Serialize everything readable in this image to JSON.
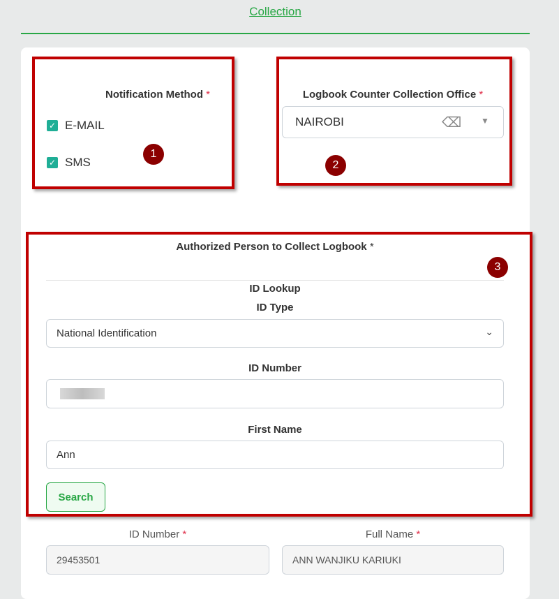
{
  "header": {
    "title": "Collection"
  },
  "notification": {
    "label": "Notification Method",
    "required": "*",
    "options": [
      {
        "label": "E-MAIL",
        "checked": true
      },
      {
        "label": "SMS",
        "checked": true
      }
    ]
  },
  "office": {
    "label": "Logbook Counter Collection Office",
    "required": "*",
    "value": "NAIROBI"
  },
  "authorized": {
    "label": "Authorized Person to Collect Logbook",
    "required": "*",
    "lookup_title": "ID Lookup",
    "id_type_label": "ID Type",
    "id_type_value": "National Identification",
    "id_number_label": "ID Number",
    "first_name_label": "First Name",
    "first_name_value": "Ann",
    "search_label": "Search"
  },
  "result": {
    "id_number_label": "ID Number",
    "id_number_value": "29453501",
    "full_name_label": "Full Name",
    "full_name_value": "ANN WANJIKU KARIUKI",
    "required": "*"
  },
  "badges": [
    "1",
    "2",
    "3"
  ],
  "colors": {
    "accent": "#28a745",
    "annotation": "#c00000",
    "badge": "#8b0000",
    "checkbox": "#1fae96"
  }
}
